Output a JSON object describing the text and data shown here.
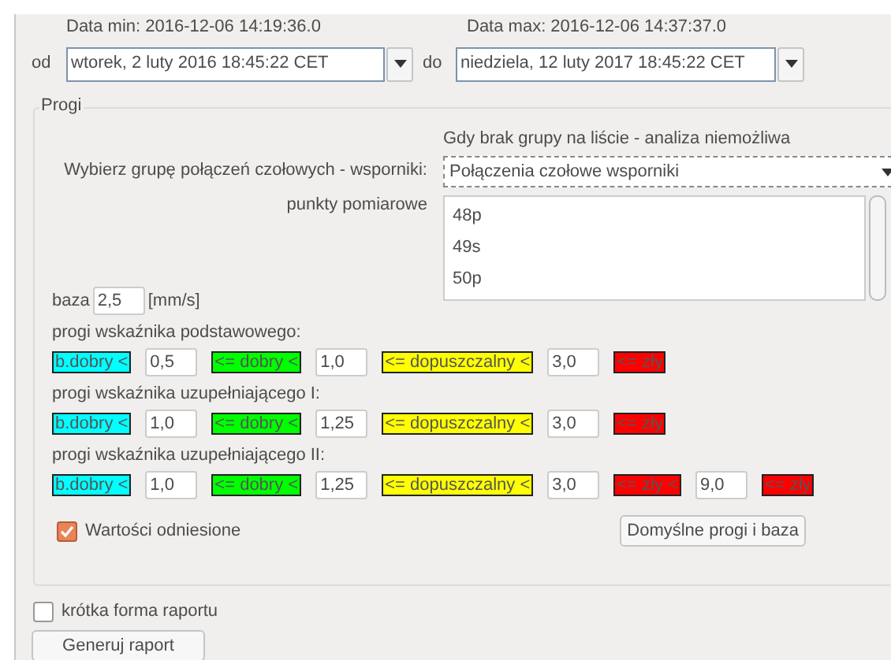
{
  "date_min": "Data min: 2016-12-06 14:19:36.0",
  "date_max": "Data max: 2016-12-06 14:37:37.0",
  "from_label": "od",
  "from_value": "wtorek, 2 luty 2016 18:45:22 CET",
  "to_label": "do",
  "to_value": "niedziela, 12 luty 2017 18:45:22 CET",
  "group": {
    "title": "Progi",
    "note": "Gdy brak grupy na liście - analiza niemożliwa",
    "select_label": "Wybierz grupę połączeń czołowych - wsporniki:",
    "select_value": "Połączenia czołowe wsporniki",
    "points_label": "punkty pomiarowe",
    "points": [
      {
        "label": "48p",
        "selected": false
      },
      {
        "label": "49s",
        "selected": false
      },
      {
        "label": "50p",
        "selected": false
      }
    ],
    "base_label": "baza",
    "base_value": "2,5",
    "base_unit": "[mm/s]",
    "thresholds": [
      {
        "title": "progi wskaźnika podstawowego:",
        "items": [
          {
            "kind": "label",
            "text": "b.dobry <",
            "color": "#00ffff"
          },
          {
            "kind": "field",
            "value": "0,5"
          },
          {
            "kind": "label",
            "text": "<= dobry <",
            "color": "#00ff00"
          },
          {
            "kind": "field",
            "value": "1,0"
          },
          {
            "kind": "label",
            "text": "<= dopuszczalny <",
            "color": "#ffff00"
          },
          {
            "kind": "field",
            "value": "3,0"
          },
          {
            "kind": "label",
            "text": "<= zły",
            "color": "#ff0000"
          }
        ]
      },
      {
        "title": "progi wskaźnika uzupełniającego I:",
        "items": [
          {
            "kind": "label",
            "text": "b.dobry <",
            "color": "#00ffff"
          },
          {
            "kind": "field",
            "value": "1,0"
          },
          {
            "kind": "label",
            "text": "<= dobry <",
            "color": "#00ff00"
          },
          {
            "kind": "field",
            "value": "1,25"
          },
          {
            "kind": "label",
            "text": "<= dopuszczalny <",
            "color": "#ffff00"
          },
          {
            "kind": "field",
            "value": "3,0"
          },
          {
            "kind": "label",
            "text": "<= zły",
            "color": "#ff0000"
          }
        ]
      },
      {
        "title": "progi wskaźnika uzupełniającego II:",
        "items": [
          {
            "kind": "label",
            "text": "b.dobry <",
            "color": "#00ffff"
          },
          {
            "kind": "field",
            "value": "1,0"
          },
          {
            "kind": "label",
            "text": "<= dobry <",
            "color": "#00ff00"
          },
          {
            "kind": "field",
            "value": "1,25"
          },
          {
            "kind": "label",
            "text": "<= dopuszczalny <",
            "color": "#ffff00"
          },
          {
            "kind": "field",
            "value": "3,0"
          },
          {
            "kind": "label",
            "text": "<= zły <",
            "color": "#ff0000"
          },
          {
            "kind": "field",
            "value": "9,0"
          },
          {
            "kind": "label",
            "text": "<= zły",
            "color": "#ff0000"
          }
        ]
      }
    ],
    "relative": {
      "label": "Wartości odniesione",
      "checked": true
    },
    "defaults_button": "Domyślne progi i baza"
  },
  "short_form": {
    "label": "krótka forma raportu",
    "checked": false
  },
  "generate_button": "Generuj raport"
}
